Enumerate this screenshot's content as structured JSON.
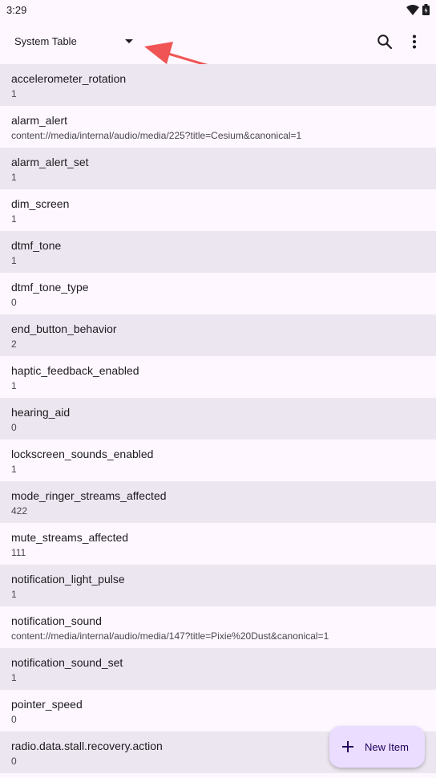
{
  "status_bar": {
    "time": "3:29"
  },
  "app_bar": {
    "table_selector": "System Table"
  },
  "rows": [
    {
      "key": "accelerometer_rotation",
      "value": "1"
    },
    {
      "key": "alarm_alert",
      "value": "content://media/internal/audio/media/225?title=Cesium&canonical=1"
    },
    {
      "key": "alarm_alert_set",
      "value": "1"
    },
    {
      "key": "dim_screen",
      "value": "1"
    },
    {
      "key": "dtmf_tone",
      "value": "1"
    },
    {
      "key": "dtmf_tone_type",
      "value": "0"
    },
    {
      "key": "end_button_behavior",
      "value": "2"
    },
    {
      "key": "haptic_feedback_enabled",
      "value": "1"
    },
    {
      "key": "hearing_aid",
      "value": "0"
    },
    {
      "key": "lockscreen_sounds_enabled",
      "value": "1"
    },
    {
      "key": "mode_ringer_streams_affected",
      "value": "422"
    },
    {
      "key": "mute_streams_affected",
      "value": "111"
    },
    {
      "key": "notification_light_pulse",
      "value": "1"
    },
    {
      "key": "notification_sound",
      "value": "content://media/internal/audio/media/147?title=Pixie%20Dust&canonical=1"
    },
    {
      "key": "notification_sound_set",
      "value": "1"
    },
    {
      "key": "pointer_speed",
      "value": "0"
    },
    {
      "key": "radio.data.stall.recovery.action",
      "value": "0"
    }
  ],
  "fab": {
    "label": "New Item"
  },
  "colors": {
    "background": "#fef7ff",
    "row_shade": "#ece6f0",
    "fab": "#eaddff",
    "annotation_arrow": "#f05454"
  },
  "icons": [
    "wifi-icon",
    "battery-icon",
    "dropdown-arrow-icon",
    "search-icon",
    "more-vert-icon",
    "plus-icon"
  ]
}
